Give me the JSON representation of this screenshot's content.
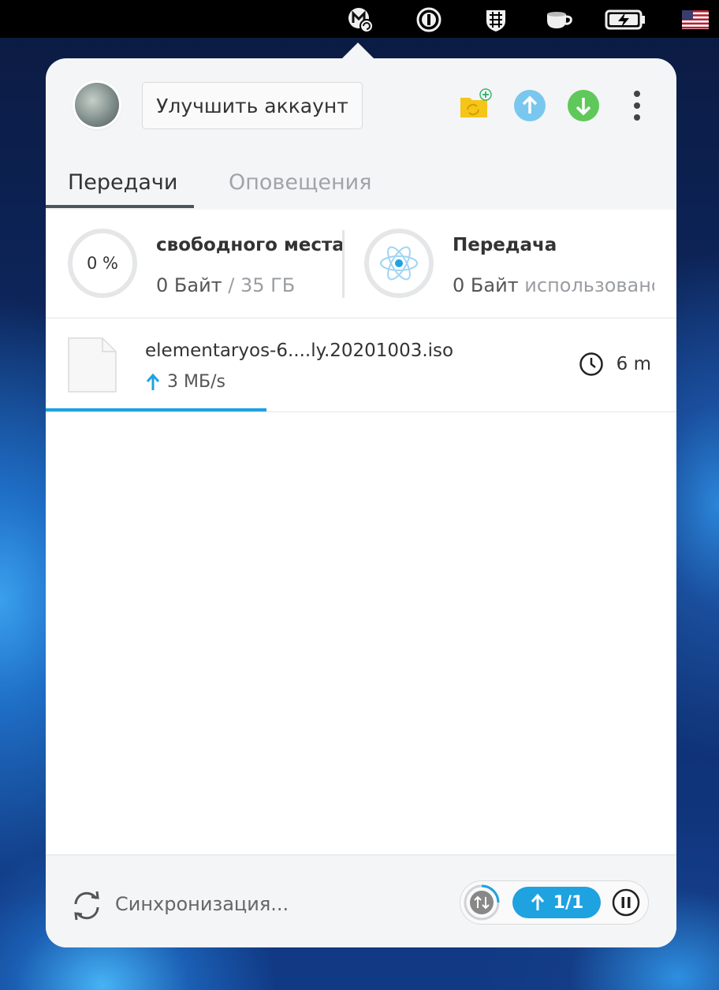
{
  "tray": {
    "icons": [
      "mega-sync-icon",
      "1password-icon",
      "firewall-icon",
      "caffeine-icon",
      "battery-charging-icon",
      "us-flag-icon"
    ]
  },
  "header": {
    "upgrade_label": "Улучшить аккаунт",
    "icons": [
      "add-sync-folder-icon",
      "upload-icon",
      "download-icon",
      "more-menu-icon"
    ]
  },
  "tabs": [
    {
      "label": "Передачи",
      "active": true
    },
    {
      "label": "Оповещения",
      "active": false
    }
  ],
  "storage": {
    "percent_label": "0 %",
    "title": "свободного места",
    "used": "0 Байт",
    "separator": " / ",
    "total": "35 ГБ"
  },
  "transfer_quota": {
    "title": "Передача",
    "used": "0 Байт",
    "suffix": " использовано"
  },
  "transfers": [
    {
      "file_name": "elementaryos-6....ly.20201003.iso",
      "speed": "3 МБ/s",
      "direction": "upload",
      "time_remaining": "6 m",
      "progress": 0.35
    }
  ],
  "footer": {
    "status": "Синхронизация...",
    "upload_count": "1/1"
  },
  "colors": {
    "accent_blue": "#1ea2e0",
    "upload_icon_blue": "#79c7ef",
    "download_icon_green": "#5fc85a",
    "folder_yellow": "#f5c518"
  }
}
